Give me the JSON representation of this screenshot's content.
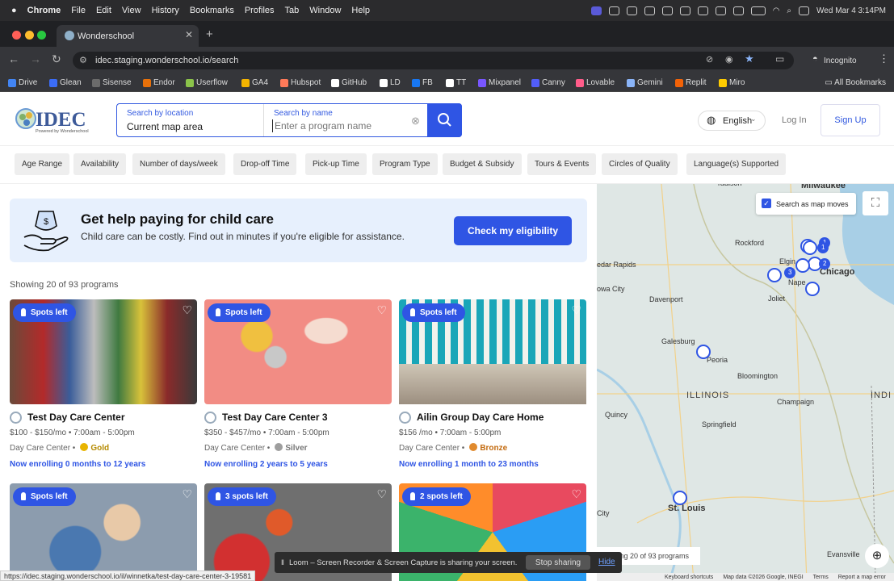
{
  "menubar": {
    "items": [
      "Chrome",
      "File",
      "Edit",
      "View",
      "History",
      "Bookmarks",
      "Profiles",
      "Tab",
      "Window",
      "Help"
    ],
    "datetime": "Wed Mar 4  3:14PM"
  },
  "browser": {
    "tab_title": "Wonderschool",
    "url": "idec.staging.wonderschool.io/search",
    "incognito_label": "Incognito",
    "bookmarks": [
      "Drive",
      "Glean",
      "Sisense",
      "Endor",
      "Userflow",
      "GA4",
      "Hubspot",
      "GitHub",
      "LD",
      "FB",
      "TT",
      "Mixpanel",
      "Canny",
      "Lovable",
      "Gemini",
      "Replit",
      "Miro"
    ],
    "bookmark_colors": [
      "#4285f4",
      "#3b6cf6",
      "#6b6b6b",
      "#e8710a",
      "#8bc34a",
      "#f4b400",
      "#ff7a59",
      "#ffffff",
      "#ffffff",
      "#1877f2",
      "#ffffff",
      "#7856ff",
      "#525df9",
      "#ff5c8a",
      "#8ab4f8",
      "#f26207",
      "#ffcc00"
    ],
    "all_bookmarks": "All Bookmarks",
    "status_url": "https://idec.staging.wonderschool.io/il/winnetka/test-day-care-center-3-19581"
  },
  "header": {
    "logo_text": "IDEC",
    "logo_sub": "Powered by Wonderschool",
    "location_label": "Search by location",
    "location_value": "Current map area",
    "name_label": "Search by name",
    "name_placeholder": "Enter a program name",
    "language": "English",
    "login": "Log In",
    "signup": "Sign Up"
  },
  "filters": [
    "Age Range",
    "Availability",
    "Number of days/week",
    "Drop-off Time",
    "Pick-up Time",
    "Program Type",
    "Budget & Subsidy",
    "Tours & Events",
    "Circles of Quality",
    "Language(s) Supported"
  ],
  "banner": {
    "title": "Get help paying for child care",
    "subtitle": "Child care can be costly. Find out in minutes if you're eligible for assistance.",
    "button": "Check my eligibility"
  },
  "results": {
    "showing": "Showing 20 of 93 programs",
    "cards": [
      {
        "spots": "Spots left",
        "name": "Test Day Care Center",
        "price": "$100 - $150/mo",
        "hours": "7:00am - 5:00pm",
        "type": "Day Care Center",
        "tier": "Gold",
        "tier_color": "#e8b400",
        "enroll": "Now enrolling 0 months to 12 years"
      },
      {
        "spots": "Spots left",
        "name": "Test Day Care Center 3",
        "price": "$350 - $457/mo",
        "hours": "7:00am - 5:00pm",
        "type": "Day Care Center",
        "tier": "Silver",
        "tier_color": "#9e9e9e",
        "enroll": "Now enrolling 2 years to 5 years"
      },
      {
        "spots": "Spots left",
        "name": "Ailin Group Day Care Home",
        "price": "$156 /mo",
        "hours": "7:00am - 5:00pm",
        "type": "Day Care Center",
        "tier": "Bronze",
        "tier_color": "#e08a2e",
        "enroll": "Now enrolling 1 month to 23 months"
      },
      {
        "spots": "Spots left"
      },
      {
        "spots": "3 spots left"
      },
      {
        "spots": "2 spots left"
      }
    ]
  },
  "map": {
    "checkbox_label": "Search as map moves",
    "labels": {
      "milwaukee": "Milwaukee",
      "rockford": "Rockford",
      "cedar_rapids": "edar Rapids",
      "elgin": "Elgin",
      "chicago": "Chicago",
      "naperville": "Nape",
      "joliet": "Joliet",
      "davenport": "Davenport",
      "iowa_city": "owa City",
      "galesburg": "Galesburg",
      "peoria": "Peoria",
      "bloomington": "Bloomington",
      "illinois": "ILLINOIS",
      "india": "INDI",
      "quincy": "Quincy",
      "champaign": "Champaign",
      "springfield": "Springfield",
      "st_louis": "St. Louis",
      "evansville": "Evansville",
      "city": "City",
      "radison": "radison"
    },
    "clusters": [
      "1",
      "1",
      "2",
      "3"
    ],
    "showing": "wing 20 of 93 programs",
    "footer": [
      "Keyboard shortcuts",
      "Map data ©2026 Google, INEGI",
      "Terms",
      "Report a map error"
    ]
  },
  "loom": {
    "message": "Loom – Screen Recorder & Screen Capture is sharing your screen.",
    "stop": "Stop sharing",
    "hide": "Hide"
  }
}
